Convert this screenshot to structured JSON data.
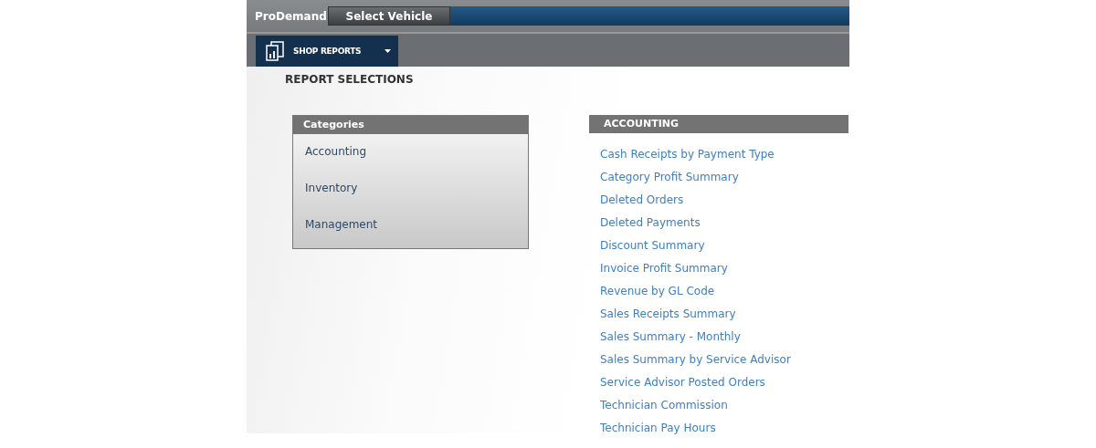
{
  "header": {
    "brand": "ProDemand",
    "vehicle_button": "Select Vehicle",
    "menu": "SHOP REPORTS"
  },
  "page_title": "REPORT SELECTIONS",
  "categories": {
    "title": "Categories",
    "items": [
      "Accounting",
      "Inventory",
      "Management"
    ]
  },
  "reports": {
    "title": "ACCOUNTING",
    "links": [
      "Cash Receipts by Payment Type",
      "Category Profit Summary",
      "Deleted Orders",
      "Deleted Payments",
      "Discount Summary",
      "Invoice Profit Summary",
      "Revenue by GL Code",
      "Sales Receipts Summary",
      "Sales Summary - Monthly",
      "Sales Summary by Service Advisor",
      "Service Advisor Posted Orders",
      "Technician Commission",
      "Technician Pay Hours"
    ]
  }
}
